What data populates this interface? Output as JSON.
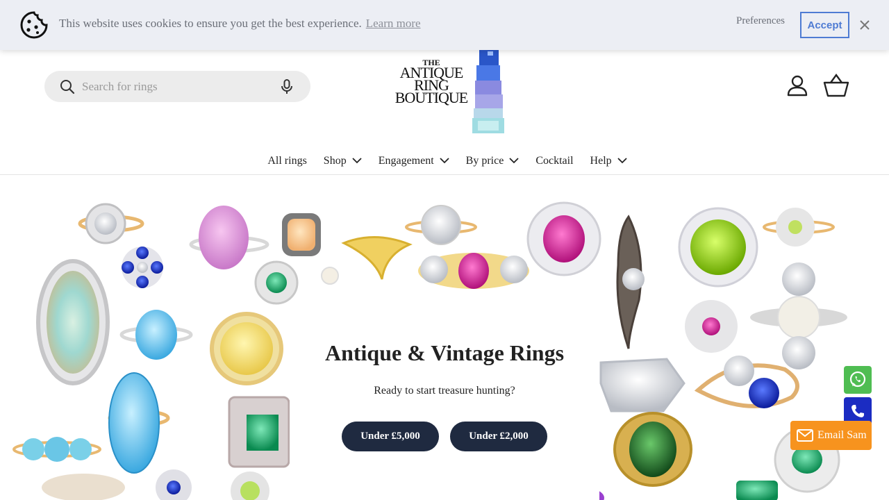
{
  "cookie": {
    "message": "This website uses cookies to ensure you get the best experience.",
    "learn_more": "Learn more",
    "preferences": "Preferences",
    "accept": "Accept"
  },
  "header": {
    "search_placeholder": "Search for rings",
    "logo": {
      "line1": "THE",
      "line2": "ANTIQUE",
      "line3": "RING",
      "line4": "BOUTIQUE"
    }
  },
  "nav": {
    "items": [
      {
        "label": "All rings",
        "dropdown": false
      },
      {
        "label": "Shop",
        "dropdown": true
      },
      {
        "label": "Engagement",
        "dropdown": true
      },
      {
        "label": "By price",
        "dropdown": true
      },
      {
        "label": "Cocktail",
        "dropdown": false
      },
      {
        "label": "Help",
        "dropdown": true
      }
    ]
  },
  "hero": {
    "title": "Antique & Vintage Rings",
    "subtitle": "Ready to start treasure hunting?",
    "button1": "Under £5,000",
    "button2": "Under £2,000"
  },
  "contact": {
    "email_label": "Email Sam"
  },
  "colors": {
    "navy_button": "#1f2a40",
    "accept_blue": "#4e7bd3",
    "whatsapp_green": "#4fbd52",
    "call_blue": "#1b2cc2",
    "email_orange": "#f7931e"
  }
}
